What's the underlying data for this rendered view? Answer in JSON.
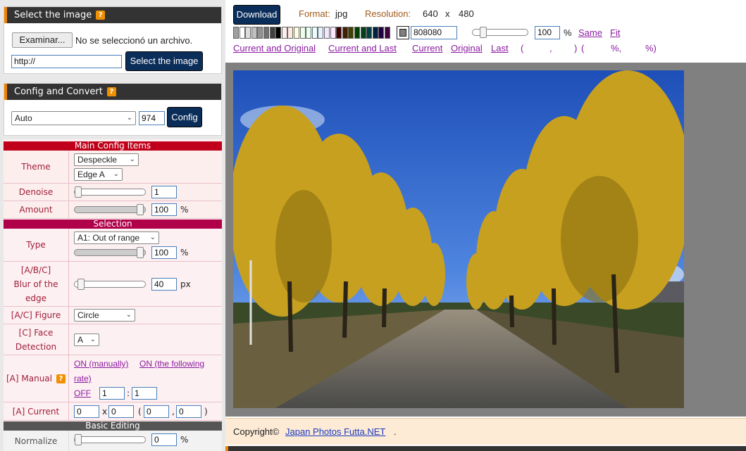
{
  "select_panel": {
    "title": "Select the image",
    "browse_label": "Examinar...",
    "no_file_text": "No se seleccionó un archivo.",
    "url_value": "http://",
    "select_button": "Select the image"
  },
  "config_panel": {
    "title": "Config and Convert",
    "mode_value": "Auto",
    "size_value": "974",
    "config_button": "Config"
  },
  "main_config": {
    "header": "Main Config Items",
    "theme_label": "Theme",
    "theme_value": "Despeckle",
    "edge_value": "Edge A",
    "denoise_label": "Denoise",
    "denoise_value": "1",
    "denoise_level": 0,
    "amount_label": "Amount",
    "amount_value": "100",
    "amount_level": 1,
    "pct": "%"
  },
  "selection": {
    "header": "Selection",
    "type_label": "Type",
    "type_value": "A1: Out of range",
    "type_pct_value": "100",
    "type_level": 1,
    "blur_label_1": "[A/B/C]",
    "blur_label_2": "Blur of the",
    "blur_label_3": "edge",
    "blur_value": "40",
    "blur_level": 0.05,
    "px": "px",
    "figure_label": "[A/C] Figure",
    "figure_value": "Circle",
    "face_label_1": "[C] Face",
    "face_label_2": "Detection",
    "face_value": "A",
    "manual_label": "[A] Manual",
    "manual_on": "ON (manually)",
    "manual_on_rate_1": "ON (the following",
    "manual_on_rate_2": "rate)",
    "manual_off": "OFF",
    "ratio_a": "1",
    "ratio_b": "1",
    "ratio_sep": ":",
    "current_label": "[A] Current",
    "cur_x": "0",
    "cur_times": "x",
    "cur_y": "0",
    "cur_open": "(",
    "cur_a": "0",
    "cur_comma": ",",
    "cur_b": "0",
    "cur_close": ")"
  },
  "basic_editing": {
    "header": "Basic Editing",
    "normalize_label": "Normalize",
    "normalize_value": "0",
    "normalize_level": 0,
    "pct": "%"
  },
  "toolbar": {
    "download": "Download",
    "format_label": "Format:",
    "format_value": "jpg",
    "resolution_label": "Resolution:",
    "res_w": "640",
    "res_x": "x",
    "res_h": "480",
    "bg_color_value": "808080",
    "zoom_value": "100",
    "zoom_level": 0.15,
    "pct": "%",
    "same": "Same",
    "fit": "Fit",
    "cmp_current_original": "Current and Original",
    "cmp_current_last": "Current and Last",
    "cmp_current": "Current",
    "cmp_original": "Original",
    "cmp_last": "Last",
    "coords_a": "(",
    "coords_b": ",",
    "coords_c": ")",
    "coords_d": "(",
    "coords_e": "%,",
    "coords_f": "%)"
  },
  "swatches": [
    "#a0a0a0",
    "#ffffff",
    "#dcdcdc",
    "#c0c0c0",
    "#909090",
    "#707070",
    "#404040",
    "#000000",
    "#ffeeee",
    "#ffe8e0",
    "#ffffe0",
    "#eeffe8",
    "#e8fff4",
    "#e8ffff",
    "#e8f0ff",
    "#f0e8ff",
    "#ffe8ff",
    "#400000",
    "#402000",
    "#404000",
    "#004000",
    "#004020",
    "#004040",
    "#002040",
    "#200040",
    "#400040"
  ],
  "swatch_selected": "#808080",
  "footer": {
    "copyright": "Copyright©",
    "link": "Japan Photos Futta.NET",
    "dot": "."
  },
  "colors": {
    "header_bg": "#333333",
    "accent": "#f08300",
    "main_config_bar": "#c0001a",
    "selection_bar": "#b0004a",
    "basic_bar": "#555555",
    "button": "#0a2d5a",
    "link": "#8a1aa0"
  }
}
